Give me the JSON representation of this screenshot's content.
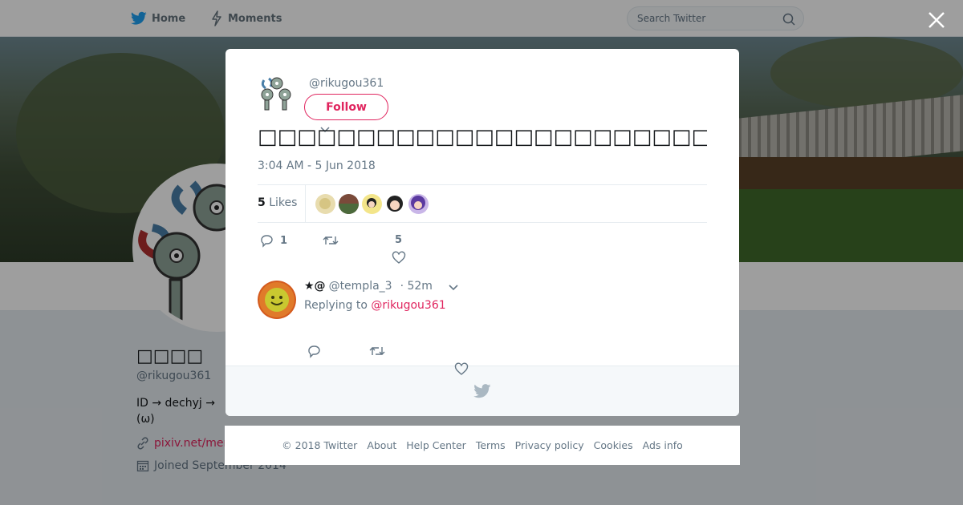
{
  "nav": {
    "home_label": "Home",
    "moments_label": "Moments",
    "search_placeholder": "Search Twitter"
  },
  "profile": {
    "display_name": "□□□□",
    "handle": "@rikugou361",
    "bio_line1": "ID → dechyj  →",
    "bio_line2": "(ω)",
    "link_text": "pixiv.net/mem",
    "joined": "Joined September 2014"
  },
  "tweet": {
    "handle": "@rikugou361",
    "follow_label": "Follow",
    "text": "□□□□□□□□□□□□□□□□□□□□□□□□□□□□□□□□□□□□□□□□",
    "timestamp": "3:04 AM - 5 Jun 2018",
    "likes_count": "5",
    "likes_label": "Likes",
    "reply_count": "1",
    "like_count": "5"
  },
  "reply": {
    "name": "★@",
    "handle": "@templa_3",
    "time": "· 52m",
    "replying_prefix": "Replying to",
    "replying_to": "@rikugou361"
  },
  "footer": {
    "copyright": "© 2018 Twitter",
    "links": [
      "About",
      "Help Center",
      "Terms",
      "Privacy policy",
      "Cookies",
      "Ads info"
    ]
  },
  "colors": {
    "accent": "#e0245e",
    "twitter_blue": "#1da1f2",
    "secondary_text": "#657786"
  }
}
